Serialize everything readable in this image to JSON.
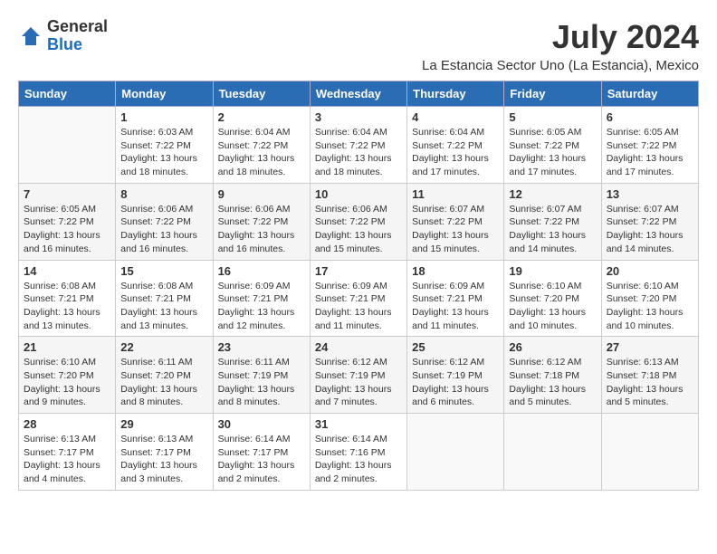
{
  "header": {
    "logo_general": "General",
    "logo_blue": "Blue",
    "month_title": "July 2024",
    "location": "La Estancia Sector Uno (La Estancia), Mexico"
  },
  "weekdays": [
    "Sunday",
    "Monday",
    "Tuesday",
    "Wednesday",
    "Thursday",
    "Friday",
    "Saturday"
  ],
  "days": [
    {
      "date": null,
      "number": "",
      "sunrise": "",
      "sunset": "",
      "daylight": ""
    },
    {
      "date": 1,
      "number": "1",
      "sunrise": "6:03 AM",
      "sunset": "7:22 PM",
      "daylight": "13 hours and 18 minutes."
    },
    {
      "date": 2,
      "number": "2",
      "sunrise": "6:04 AM",
      "sunset": "7:22 PM",
      "daylight": "13 hours and 18 minutes."
    },
    {
      "date": 3,
      "number": "3",
      "sunrise": "6:04 AM",
      "sunset": "7:22 PM",
      "daylight": "13 hours and 18 minutes."
    },
    {
      "date": 4,
      "number": "4",
      "sunrise": "6:04 AM",
      "sunset": "7:22 PM",
      "daylight": "13 hours and 17 minutes."
    },
    {
      "date": 5,
      "number": "5",
      "sunrise": "6:05 AM",
      "sunset": "7:22 PM",
      "daylight": "13 hours and 17 minutes."
    },
    {
      "date": 6,
      "number": "6",
      "sunrise": "6:05 AM",
      "sunset": "7:22 PM",
      "daylight": "13 hours and 17 minutes."
    },
    {
      "date": 7,
      "number": "7",
      "sunrise": "6:05 AM",
      "sunset": "7:22 PM",
      "daylight": "13 hours and 16 minutes."
    },
    {
      "date": 8,
      "number": "8",
      "sunrise": "6:06 AM",
      "sunset": "7:22 PM",
      "daylight": "13 hours and 16 minutes."
    },
    {
      "date": 9,
      "number": "9",
      "sunrise": "6:06 AM",
      "sunset": "7:22 PM",
      "daylight": "13 hours and 16 minutes."
    },
    {
      "date": 10,
      "number": "10",
      "sunrise": "6:06 AM",
      "sunset": "7:22 PM",
      "daylight": "13 hours and 15 minutes."
    },
    {
      "date": 11,
      "number": "11",
      "sunrise": "6:07 AM",
      "sunset": "7:22 PM",
      "daylight": "13 hours and 15 minutes."
    },
    {
      "date": 12,
      "number": "12",
      "sunrise": "6:07 AM",
      "sunset": "7:22 PM",
      "daylight": "13 hours and 14 minutes."
    },
    {
      "date": 13,
      "number": "13",
      "sunrise": "6:07 AM",
      "sunset": "7:22 PM",
      "daylight": "13 hours and 14 minutes."
    },
    {
      "date": 14,
      "number": "14",
      "sunrise": "6:08 AM",
      "sunset": "7:21 PM",
      "daylight": "13 hours and 13 minutes."
    },
    {
      "date": 15,
      "number": "15",
      "sunrise": "6:08 AM",
      "sunset": "7:21 PM",
      "daylight": "13 hours and 13 minutes."
    },
    {
      "date": 16,
      "number": "16",
      "sunrise": "6:09 AM",
      "sunset": "7:21 PM",
      "daylight": "13 hours and 12 minutes."
    },
    {
      "date": 17,
      "number": "17",
      "sunrise": "6:09 AM",
      "sunset": "7:21 PM",
      "daylight": "13 hours and 11 minutes."
    },
    {
      "date": 18,
      "number": "18",
      "sunrise": "6:09 AM",
      "sunset": "7:21 PM",
      "daylight": "13 hours and 11 minutes."
    },
    {
      "date": 19,
      "number": "19",
      "sunrise": "6:10 AM",
      "sunset": "7:20 PM",
      "daylight": "13 hours and 10 minutes."
    },
    {
      "date": 20,
      "number": "20",
      "sunrise": "6:10 AM",
      "sunset": "7:20 PM",
      "daylight": "13 hours and 10 minutes."
    },
    {
      "date": 21,
      "number": "21",
      "sunrise": "6:10 AM",
      "sunset": "7:20 PM",
      "daylight": "13 hours and 9 minutes."
    },
    {
      "date": 22,
      "number": "22",
      "sunrise": "6:11 AM",
      "sunset": "7:20 PM",
      "daylight": "13 hours and 8 minutes."
    },
    {
      "date": 23,
      "number": "23",
      "sunrise": "6:11 AM",
      "sunset": "7:19 PM",
      "daylight": "13 hours and 8 minutes."
    },
    {
      "date": 24,
      "number": "24",
      "sunrise": "6:12 AM",
      "sunset": "7:19 PM",
      "daylight": "13 hours and 7 minutes."
    },
    {
      "date": 25,
      "number": "25",
      "sunrise": "6:12 AM",
      "sunset": "7:19 PM",
      "daylight": "13 hours and 6 minutes."
    },
    {
      "date": 26,
      "number": "26",
      "sunrise": "6:12 AM",
      "sunset": "7:18 PM",
      "daylight": "13 hours and 5 minutes."
    },
    {
      "date": 27,
      "number": "27",
      "sunrise": "6:13 AM",
      "sunset": "7:18 PM",
      "daylight": "13 hours and 5 minutes."
    },
    {
      "date": 28,
      "number": "28",
      "sunrise": "6:13 AM",
      "sunset": "7:17 PM",
      "daylight": "13 hours and 4 minutes."
    },
    {
      "date": 29,
      "number": "29",
      "sunrise": "6:13 AM",
      "sunset": "7:17 PM",
      "daylight": "13 hours and 3 minutes."
    },
    {
      "date": 30,
      "number": "30",
      "sunrise": "6:14 AM",
      "sunset": "7:17 PM",
      "daylight": "13 hours and 2 minutes."
    },
    {
      "date": 31,
      "number": "31",
      "sunrise": "6:14 AM",
      "sunset": "7:16 PM",
      "daylight": "13 hours and 2 minutes."
    }
  ]
}
